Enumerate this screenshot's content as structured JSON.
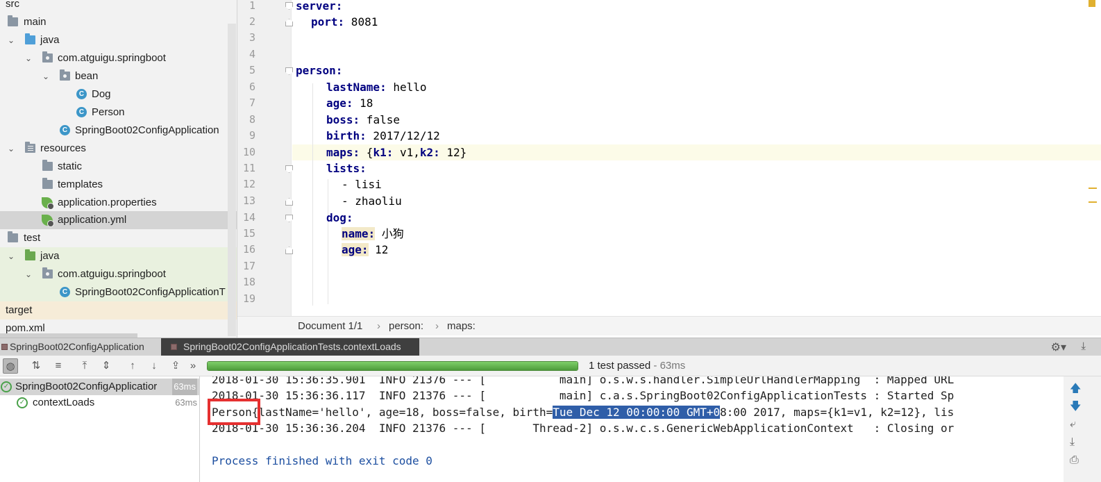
{
  "project_tree": {
    "items": [
      {
        "label": "src"
      },
      {
        "label": "main"
      },
      {
        "label": "java"
      },
      {
        "label": "com.atguigu.springboot"
      },
      {
        "label": "bean"
      },
      {
        "label": "Dog"
      },
      {
        "label": "Person"
      },
      {
        "label": "SpringBoot02ConfigApplication"
      },
      {
        "label": "resources"
      },
      {
        "label": "static"
      },
      {
        "label": "templates"
      },
      {
        "label": "application.properties"
      },
      {
        "label": "application.yml"
      },
      {
        "label": "test"
      },
      {
        "label": "java"
      },
      {
        "label": "com.atguigu.springboot"
      },
      {
        "label": "SpringBoot02ConfigApplicationT"
      },
      {
        "label": "target"
      },
      {
        "label": "pom.xml"
      }
    ]
  },
  "editor": {
    "line_numbers": [
      "1",
      "2",
      "3",
      "4",
      "5",
      "6",
      "7",
      "8",
      "9",
      "10",
      "11",
      "12",
      "13",
      "14",
      "15",
      "16",
      "17",
      "18",
      "19"
    ],
    "lines": [
      {
        "key": "server:",
        "rest": ""
      },
      {
        "key": "port:",
        "rest": " 8081"
      },
      {
        "key": "",
        "rest": ""
      },
      {
        "key": "",
        "rest": ""
      },
      {
        "key": "person:",
        "rest": ""
      },
      {
        "key": "lastName:",
        "rest": " hello"
      },
      {
        "key": "age:",
        "rest": " 18"
      },
      {
        "key": "boss:",
        "rest": " false"
      },
      {
        "key": "birth:",
        "rest": " 2017/12/12"
      },
      {
        "key": "maps:",
        "rest": " {",
        "k1": "k1:",
        "v1": " v1,",
        "k2": "k2:",
        "v2": " 12}"
      },
      {
        "key": "lists:",
        "rest": ""
      },
      {
        "key": "",
        "rest": "- lisi"
      },
      {
        "key": "",
        "rest": "- zhaoliu"
      },
      {
        "key": "dog:",
        "rest": ""
      },
      {
        "key": "name:",
        "rest": " 小狗"
      },
      {
        "key": "age:",
        "rest": " 12"
      }
    ],
    "breadcrumb": [
      "Document 1/1",
      "person:",
      "maps:"
    ]
  },
  "run_tabs": [
    "SpringBoot02ConfigApplication",
    "SpringBoot02ConfigApplicationTests.contextLoads"
  ],
  "run_toolbar": {
    "status": "1 test passed",
    "duration": " - 63ms",
    "progress": 1.0
  },
  "test_tree": [
    {
      "label": "SpringBoot02ConfigApplicatior",
      "time": "63ms"
    },
    {
      "label": "contextLoads",
      "time": "63ms"
    }
  ],
  "console": {
    "line1": "2018-01-30 15:36:35.901  INFO 21376 --- [           main] o.s.w.s.handler.SimpleUrlHandlerMapping  : Mapped URL",
    "line2": "2018-01-30 15:36:36.117  INFO 21376 --- [           main] c.a.s.SpringBoot02ConfigApplicationTests : Started Sp",
    "line3_pre": "Person{lastName='hello', age=18, boss=false, birth=",
    "line3_sel": "Tue Dec 12 00:00:00 GMT+0",
    "line3_post": "8:00 2017, maps={k1=v1, k2=12}, lis",
    "line4": "2018-01-30 15:36:36.204  INFO 21376 --- [       Thread-2] o.s.w.c.s.GenericWebApplicationContext   : Closing or",
    "exit": "Process finished with exit code 0"
  },
  "colors": {
    "accent": "#2f5ea8",
    "pass": "#4aa14a",
    "highlight_box": "#e53030"
  }
}
